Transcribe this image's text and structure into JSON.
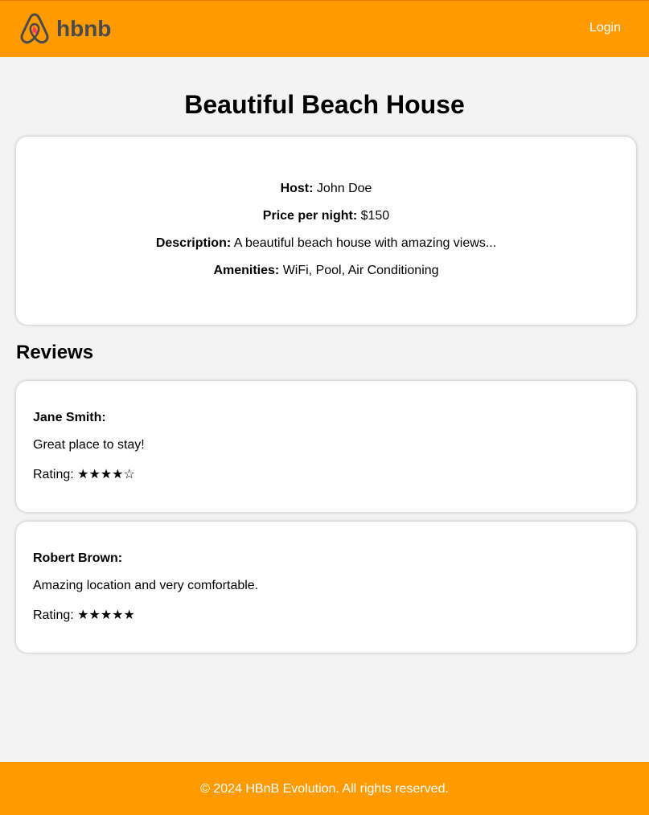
{
  "header": {
    "logo_text": "hbnb",
    "login_label": "Login"
  },
  "place": {
    "title": "Beautiful Beach House",
    "host_label": "Host:",
    "host_value": "John Doe",
    "price_label": "Price per night:",
    "price_value": "$150",
    "description_label": "Description:",
    "description_value": "A beautiful beach house with amazing views...",
    "amenities_label": "Amenities:",
    "amenities_value": "WiFi, Pool, Air Conditioning"
  },
  "reviews": {
    "heading": "Reviews",
    "items": [
      {
        "author": "Jane Smith:",
        "text": "Great place to stay!",
        "rating_text": "Rating: ★★★★☆",
        "rating": 4
      },
      {
        "author": "Robert Brown:",
        "text": "Amazing location and very comfortable.",
        "rating_text": "Rating: ★★★★★",
        "rating": 5
      }
    ]
  },
  "footer": {
    "text": "© 2024 HBnB Evolution. All rights reserved."
  },
  "colors": {
    "brand": "#ff9a00",
    "logo_text": "#4a4a4a",
    "logo_accent": "#ff385c",
    "background": "#f3f3f3"
  },
  "icons": {
    "logo": "airbnb-logo-icon"
  }
}
